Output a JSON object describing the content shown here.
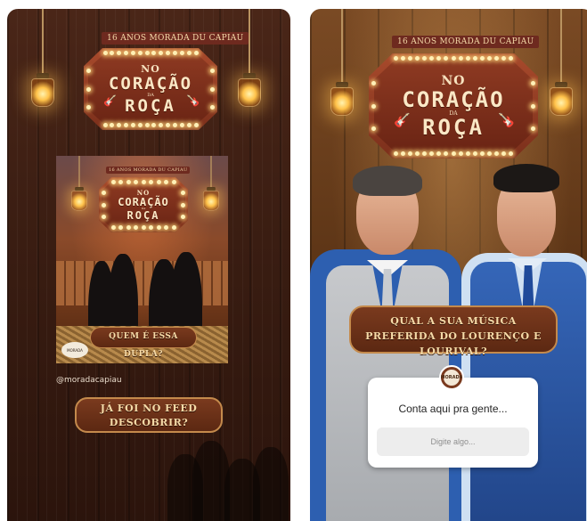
{
  "left_story": {
    "tag": "16 ANOS MORADA DU CAPIAU",
    "sign": {
      "no": "NO",
      "coracao": "CORAÇÃO",
      "da": "DA",
      "roca": "ROÇA"
    },
    "post": {
      "tag": "16 ANOS MORADA DU CAPIAU",
      "sign": {
        "no": "NO",
        "coracao": "CORAÇÃO",
        "da": "DA",
        "roca": "ROÇA"
      },
      "question": "QUEM É ESSA DUPLA?",
      "logo_text": "MORADA"
    },
    "handle": "@moradacapiau",
    "feed_button": "JÁ FOI NO FEED DESCOBRIR?"
  },
  "right_story": {
    "tag": "16 ANOS MORADA DU CAPIAU",
    "sign": {
      "no": "NO",
      "coracao": "CORAÇÃO",
      "da": "DA",
      "roca": "ROÇA"
    },
    "question_banner": "QUAL A SUA MÚSICA PREFERIDA DO LOURENÇO E LOURIVAL?",
    "question_card": {
      "avatar_text": "MORADA",
      "prompt": "Conta aqui pra gente...",
      "placeholder": "Digite algo..."
    }
  },
  "colors": {
    "wood_dark": "#3a1d12",
    "sign_red": "#8e3a22",
    "gold_border": "#c48a4c",
    "cream_text": "#f6dba8",
    "shirt_blue": "#2d5fb0",
    "vest_grey": "#b9bcc0",
    "vest_blue": "#2c58a8"
  },
  "icons": [
    "lamp-icon",
    "guitar-icon"
  ]
}
